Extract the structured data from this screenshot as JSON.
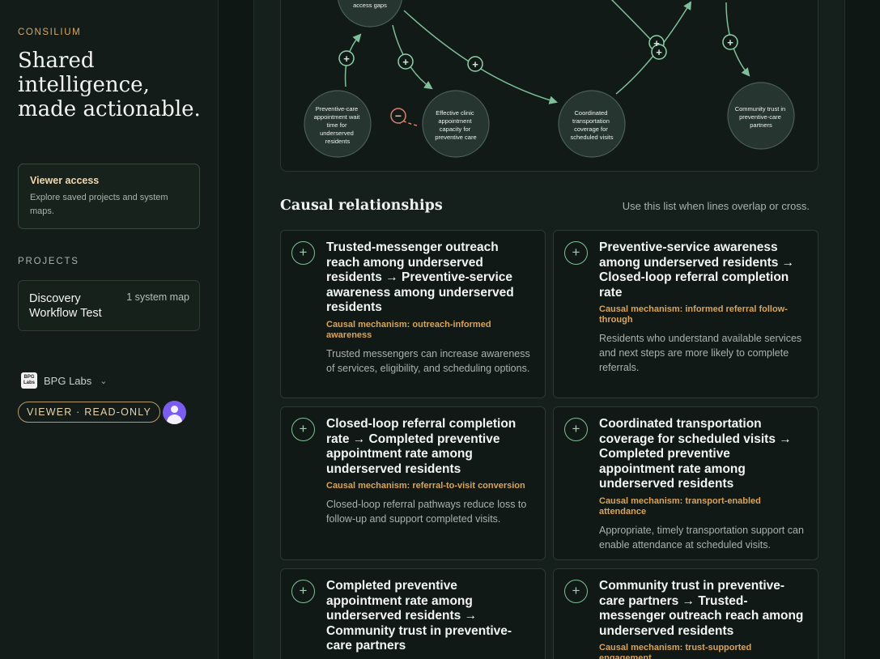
{
  "sidebar": {
    "brand": "CONSILIUM",
    "tagline": "Shared intelligence, made actionable.",
    "viewer_card": {
      "title": "Viewer access",
      "description": "Explore saved projects and system maps."
    },
    "projects_label": "PROJECTS",
    "project": {
      "name": "Discovery Workflow Test",
      "meta": "1 system map"
    },
    "org": {
      "logo_text": "BPG Labs",
      "name": "BPG Labs"
    },
    "role": "VIEWER · READ-ONLY"
  },
  "map": {
    "nodes": [
      {
        "id": "access",
        "label": "access gaps"
      },
      {
        "id": "waittime",
        "label": "Preventive-care appointment wait time for underserved residents"
      },
      {
        "id": "capacity",
        "label": "Effective clinic appointment capacity for preventive care"
      },
      {
        "id": "transport",
        "label": "Coordinated transportation coverage for scheduled visits"
      },
      {
        "id": "trust",
        "label": "Community trust in preventive-care partners"
      }
    ],
    "positive_sign": "+",
    "negative_sign": "−",
    "colors": {
      "positive": "#7fbf9a",
      "negative": "#d9826f",
      "node_fill": "#26352f"
    }
  },
  "relationships": {
    "title": "Causal relationships",
    "hint": "Use this list when lines overlap or cross.",
    "items": [
      {
        "sign": "+",
        "title": "Trusted-messenger outreach reach among underserved residents → Preventive-service awareness among underserved residents",
        "mechanism": "Causal mechanism: outreach-informed awareness",
        "description": "Trusted messengers can increase awareness of services, eligibility, and scheduling options."
      },
      {
        "sign": "+",
        "title": "Preventive-service awareness among underserved residents → Closed-loop referral completion rate",
        "mechanism": "Causal mechanism: informed referral follow-through",
        "description": "Residents who understand available services and next steps are more likely to complete referrals."
      },
      {
        "sign": "+",
        "title": "Closed-loop referral completion rate → Completed preventive appointment rate among underserved residents",
        "mechanism": "Causal mechanism: referral-to-visit conversion",
        "description": "Closed-loop referral pathways reduce loss to follow-up and support completed visits."
      },
      {
        "sign": "+",
        "title": "Coordinated transportation coverage for scheduled visits → Completed preventive appointment rate among underserved residents",
        "mechanism": "Causal mechanism: transport-enabled attendance",
        "description": "Appropriate, timely transportation support can enable attendance at scheduled visits."
      },
      {
        "sign": "+",
        "title": "Completed preventive appointment rate among underserved residents → Community trust in preventive-care partners",
        "mechanism": "",
        "description": ""
      },
      {
        "sign": "+",
        "title": "Community trust in preventive-care partners → Trusted-messenger outreach reach among underserved residents",
        "mechanism": "Causal mechanism: trust-supported engagement",
        "description": ""
      }
    ]
  }
}
